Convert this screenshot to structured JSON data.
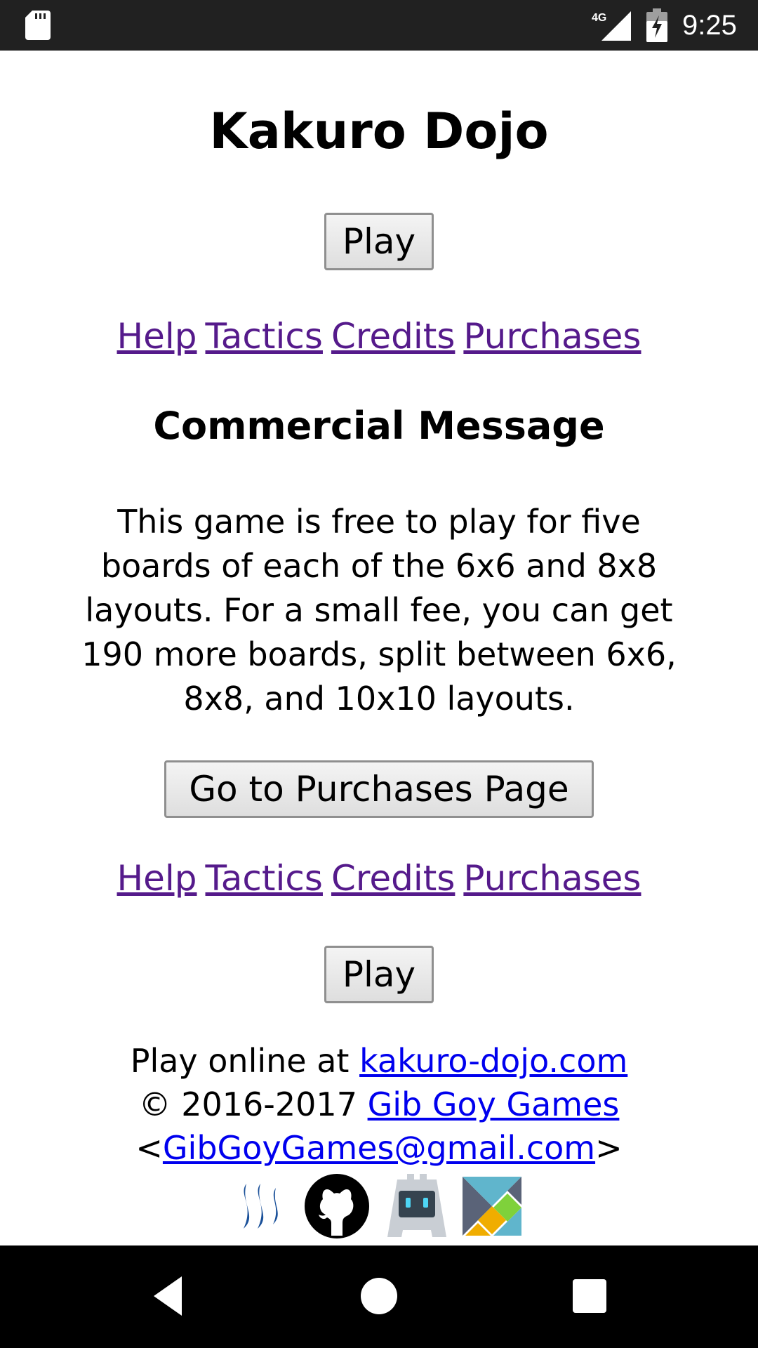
{
  "status_bar": {
    "time": "9:25",
    "network": "4G",
    "icons": [
      "sd-card-icon",
      "signal-icon",
      "battery-charging-icon"
    ]
  },
  "page": {
    "title": "Kakuro Dojo",
    "play_label": "Play",
    "nav_links": [
      "Help",
      "Tactics",
      "Credits",
      "Purchases"
    ],
    "commercial_heading": "Commercial Message",
    "commercial_text": "This game is free to play for five boards of each of the 6x6 and 8x8 layouts. For a small fee, you can get 190 more boards, split between 6x6, 8x8, and 10x10 layouts.",
    "purchases_button_label": "Go to Purchases Page"
  },
  "footer": {
    "play_online_prefix": "Play online at",
    "site_link": "kakuro-dojo.com",
    "copyright": "© 2016-2017",
    "company_link": "Gib Goy Games",
    "email_open": "<",
    "email_link": "GibGoyGames@gmail.com",
    "email_close": ">",
    "logos": [
      "steem-logo",
      "github-logo",
      "cordova-logo",
      "elm-logo"
    ]
  },
  "navigation_bar": {
    "icons": [
      "back-icon",
      "home-icon",
      "recent-apps-icon"
    ]
  },
  "colors": {
    "status_bar": "#212121",
    "visited_link": "#551a8b",
    "link": "#0000ee",
    "nav_bar": "#000000"
  }
}
